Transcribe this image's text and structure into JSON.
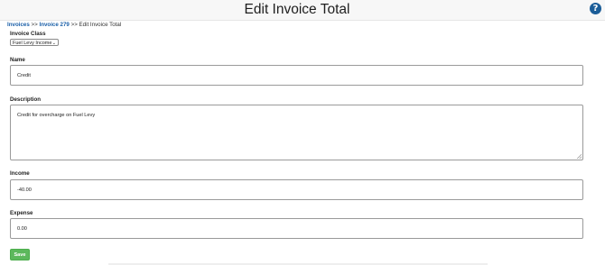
{
  "header": {
    "title": "Edit Invoice Total",
    "help_symbol": "?"
  },
  "breadcrumb": {
    "items": [
      "Invoices",
      "Invoice 279",
      "Edit Invoice Total"
    ],
    "separator": ">>"
  },
  "form": {
    "invoice_class": {
      "label": "Invoice Class",
      "selected": "Fuel Levy Income"
    },
    "name": {
      "label": "Name",
      "value": "Credit"
    },
    "description": {
      "label": "Description",
      "value": "Credit for overcharge on Fuel Levy"
    },
    "income": {
      "label": "Income",
      "value": "-40.00"
    },
    "expense": {
      "label": "Expense",
      "value": "0.00"
    },
    "save_label": "Save"
  },
  "colors": {
    "link": "#1a5fa8",
    "help_icon": "#1b5d98",
    "save_button": "#5cb85c"
  }
}
